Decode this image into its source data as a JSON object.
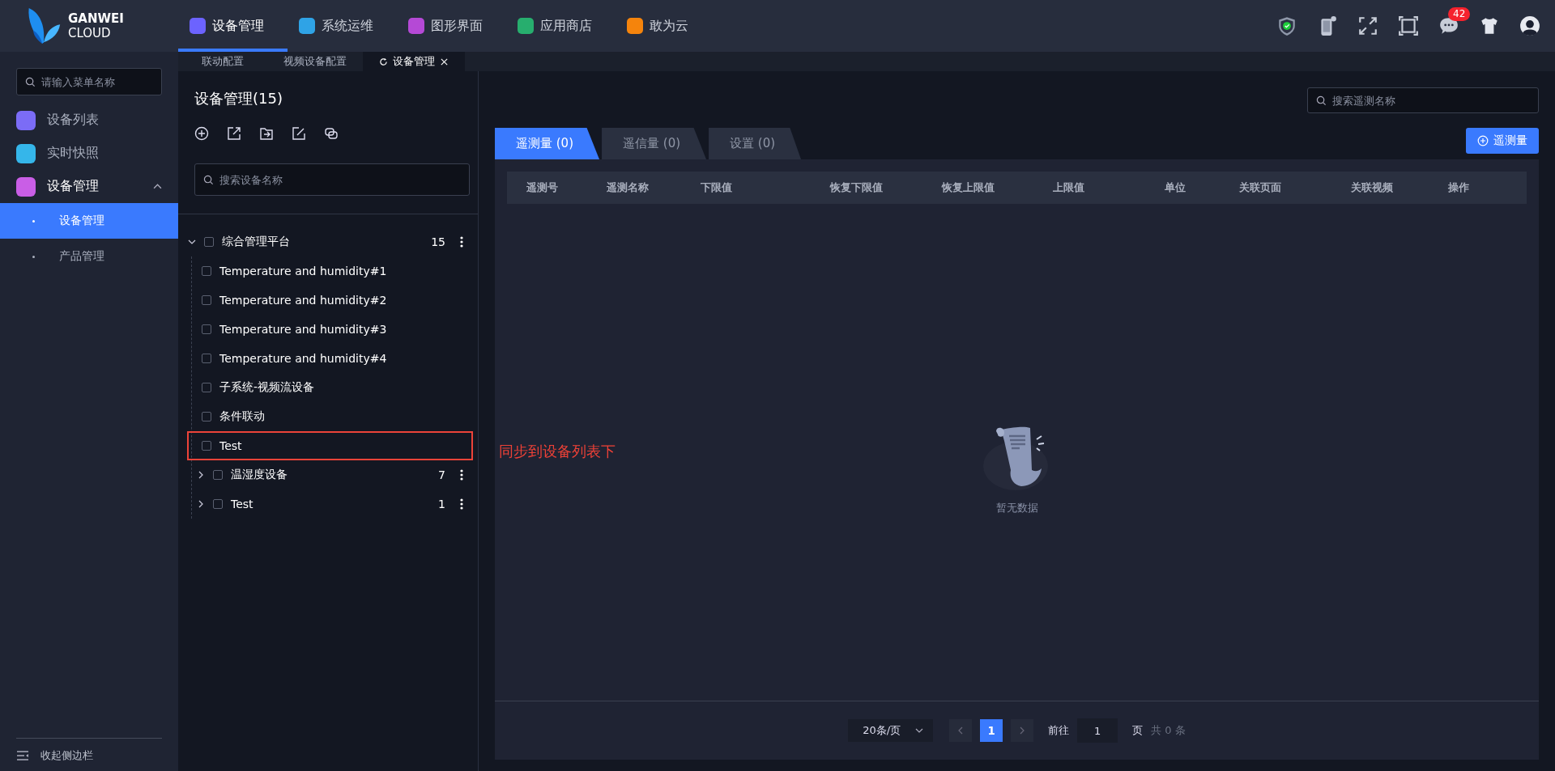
{
  "brand": {
    "name": "GANWEI",
    "sub": "CLOUD"
  },
  "top_nav": [
    {
      "label": "设备管理",
      "color": "#6c63ff",
      "selected": true
    },
    {
      "label": "系统运维",
      "color": "#2fa3e6",
      "selected": false
    },
    {
      "label": "图形界面",
      "color": "#b549d6",
      "selected": false
    },
    {
      "label": "应用商店",
      "color": "#27ae6e",
      "selected": false
    },
    {
      "label": "敢为云",
      "color": "#f5840c",
      "selected": false
    }
  ],
  "notifications_badge": "42",
  "sidebar": {
    "search": {
      "placeholder": "请输入菜单名称"
    },
    "items": [
      {
        "label": "设备列表",
        "color": "#7b6cf6",
        "expanded": false
      },
      {
        "label": "实时快照",
        "color": "#35b6ea",
        "expanded": false
      },
      {
        "label": "设备管理",
        "color": "#c95ee6",
        "expanded": true,
        "children": [
          {
            "label": "设备管理",
            "selected": true
          },
          {
            "label": "产品管理",
            "selected": false
          }
        ]
      }
    ],
    "collapse": "收起侧边栏"
  },
  "page_tabs": [
    {
      "label": "联动配置",
      "selected": false,
      "closable": false
    },
    {
      "label": "视频设备配置",
      "selected": false,
      "closable": false
    },
    {
      "label": "设备管理",
      "selected": true,
      "closable": true
    }
  ],
  "tree_panel": {
    "title": "设备管理(15)",
    "search": {
      "placeholder": "搜索设备名称"
    },
    "tree": [
      {
        "label": "综合管理平台",
        "count": "15",
        "checked": false,
        "expanded": true,
        "children": [
          {
            "label": "Temperature and humidity#1",
            "checked": false
          },
          {
            "label": "Temperature and humidity#2",
            "checked": false
          },
          {
            "label": "Temperature and humidity#3",
            "checked": false
          },
          {
            "label": "Temperature and humidity#4",
            "checked": false
          },
          {
            "label": "子系统-视频流设备",
            "checked": false
          },
          {
            "label": "条件联动",
            "checked": false
          },
          {
            "label": "Test",
            "checked": false,
            "annotated": true
          },
          {
            "label": "温湿度设备",
            "count": "7",
            "checked": false,
            "expanded": false
          },
          {
            "label": "Test",
            "count": "1",
            "checked": false,
            "expanded": false
          }
        ]
      }
    ]
  },
  "annotation": "同步到设备列表下",
  "content": {
    "search": {
      "placeholder": "搜索遥测名称"
    },
    "tabs": [
      {
        "label": "遥测量 (0)",
        "selected": true
      },
      {
        "label": "遥信量 (0)",
        "selected": false
      },
      {
        "label": "设置 (0)",
        "selected": false
      }
    ],
    "add_button": "遥测量",
    "table": {
      "columns": [
        "遥测号",
        "遥测名称",
        "下限值",
        "恢复下限值",
        "恢复上限值",
        "上限值",
        "单位",
        "关联页面",
        "关联视频",
        "操作"
      ],
      "empty_text": "暂无数据"
    },
    "pagination": {
      "page_size": "20条/页",
      "pages": [
        {
          "label": "1",
          "selected": true
        }
      ],
      "goto_label": "前往",
      "goto_value": "1",
      "page_unit": "页",
      "total": "共 0 条"
    }
  }
}
